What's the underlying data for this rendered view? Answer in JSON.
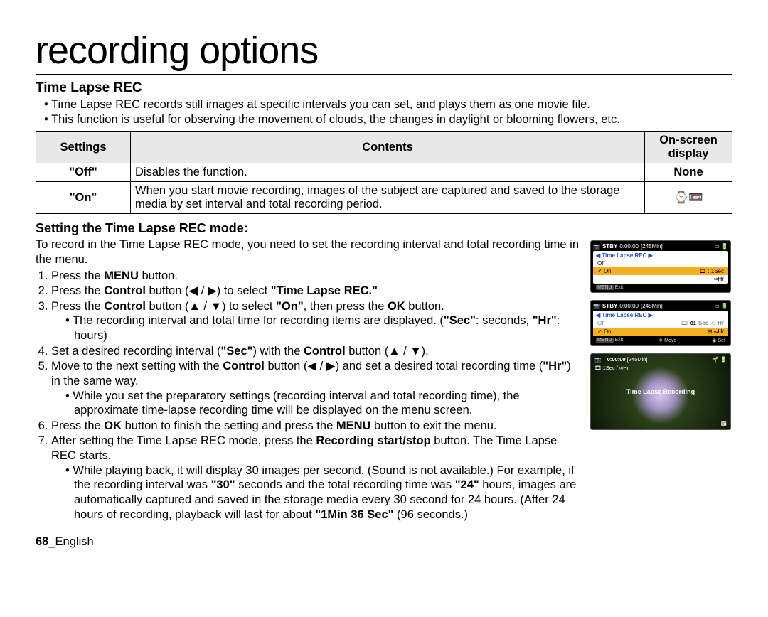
{
  "page_title": "recording options",
  "section_title": "Time Lapse REC",
  "intro_bullets": [
    "Time Lapse REC records still images at specific intervals you can set, and plays them as one movie file.",
    "This function is useful for observing the movement of clouds, the changes in daylight or blooming flowers, etc."
  ],
  "table": {
    "headers": {
      "settings": "Settings",
      "contents": "Contents",
      "display": "On-screen display"
    },
    "rows": [
      {
        "setting": "\"Off\"",
        "contents": "Disables the function.",
        "display": "None"
      },
      {
        "setting": "\"On\"",
        "contents": "When you start movie recording, images of the subject are captured and saved to the storage media by set interval and total recording period.",
        "display_icon": "⌚📼"
      }
    ]
  },
  "subsection_title": "Setting the Time Lapse REC mode:",
  "intro_text": "To record in the Time Lapse REC mode, you need to set the recording interval and total recording time in the menu.",
  "steps": {
    "s1_a": "Press the ",
    "s1_b": "MENU",
    "s1_c": " button.",
    "s2_a": "Press the ",
    "s2_b": "Control",
    "s2_c": " button (",
    "s2_d": "◀",
    "s2_e": " / ",
    "s2_f": "▶",
    "s2_g": ") to select ",
    "s2_h": "\"Time Lapse REC.\"",
    "s3_a": "Press the ",
    "s3_b": "Control",
    "s3_c": " button (",
    "s3_d": "▲",
    "s3_e": " / ",
    "s3_f": "▼",
    "s3_g": ") to select ",
    "s3_h": "\"On\"",
    "s3_i": ", then press the ",
    "s3_j": "OK",
    "s3_k": " button.",
    "s3_sub_a": "The recording interval and total time for recording items are displayed. (",
    "s3_sub_b": "\"Sec\"",
    "s3_sub_c": ": seconds, ",
    "s3_sub_d": "\"Hr\"",
    "s3_sub_e": ": hours)",
    "s4_a": "Set a desired recording interval (",
    "s4_b": "\"Sec\"",
    "s4_c": ") with the ",
    "s4_d": "Control",
    "s4_e": " button (",
    "s4_f": "▲",
    "s4_g": " / ",
    "s4_h": "▼",
    "s4_i": ").",
    "s5_a": "Move to the next setting with the ",
    "s5_b": "Control",
    "s5_c": " button (",
    "s5_d": "◀",
    "s5_e": " / ",
    "s5_f": "▶",
    "s5_g": ") and set a desired total recording time (",
    "s5_h": "\"Hr\"",
    "s5_i": ") in the same way.",
    "s5_sub": "While you set the preparatory settings (recording interval and total recording time), the approximate time-lapse recording time will be displayed on the menu screen.",
    "s6_a": "Press the ",
    "s6_b": "OK",
    "s6_c": " button to finish the setting and press the ",
    "s6_d": "MENU",
    "s6_e": " button to exit the menu.",
    "s7_a": "After setting the Time Lapse REC mode, press the ",
    "s7_b": "Recording start/stop",
    "s7_c": " button. The Time Lapse REC starts.",
    "s7_sub_a": "While playing back, it will display 30 images per second. (Sound is not available.) For example, if the recording interval was ",
    "s7_sub_b": "\"30\"",
    "s7_sub_c": " seconds and the total recording time was ",
    "s7_sub_d": "\"24\"",
    "s7_sub_e": " hours, images are automatically captured and saved in the storage media every 30 second for 24 hours. (After 24 hours of recording, playback will last for about ",
    "s7_sub_f": "\"1Min 36 Sec\"",
    "s7_sub_g": " (96 seconds.)"
  },
  "lcd1": {
    "stby": "STBY",
    "time": "0:00:00",
    "remain": "[245Min]",
    "title": "Time Lapse REC",
    "off": "Off",
    "on": "On",
    "sec": "1Sec",
    "hr": "∞Hr",
    "menu": "MENU",
    "exit": "Exit"
  },
  "lcd2": {
    "stby": "STBY",
    "time": "0:00:00",
    "remain": "[245Min]",
    "title": "Time Lapse REC",
    "off": "Off",
    "on": "On",
    "box01": "01",
    "sec": "Sec",
    "hricon": "∞",
    "hr": "Hr",
    "hrline": "⊞ ∞Hr",
    "menu": "MENU",
    "exit": "Exit",
    "move": "Move",
    "set": "Set"
  },
  "lcd3": {
    "time": "0:00:00",
    "remain": "[245Min]",
    "line2": "1Sec / ∞Hr",
    "center": "Time Lapse Recording"
  },
  "footer": {
    "page": "68",
    "sep": "_",
    "lang": "English"
  }
}
